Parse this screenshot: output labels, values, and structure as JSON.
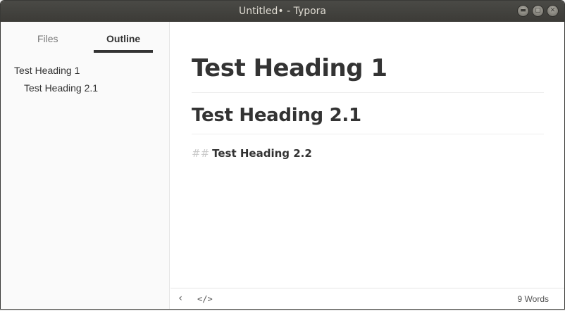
{
  "window": {
    "title": "Untitled• - Typora",
    "controls": [
      "minimize-icon",
      "maximize-icon",
      "close-icon"
    ]
  },
  "sidebar": {
    "tabs": [
      {
        "label": "Files",
        "active": false
      },
      {
        "label": "Outline",
        "active": true
      }
    ],
    "outline": [
      {
        "label": "Test Heading 1",
        "level": 1
      },
      {
        "label": "Test Heading 2.1",
        "level": 2
      }
    ]
  },
  "editor": {
    "h1": "Test Heading 1",
    "h2": "Test Heading 2.1",
    "h3_marker": "##",
    "h3": "Test Heading 2.2"
  },
  "footer": {
    "back_icon": "chevron-left-icon",
    "source_icon": "code-icon",
    "word_count": "9 Words"
  }
}
